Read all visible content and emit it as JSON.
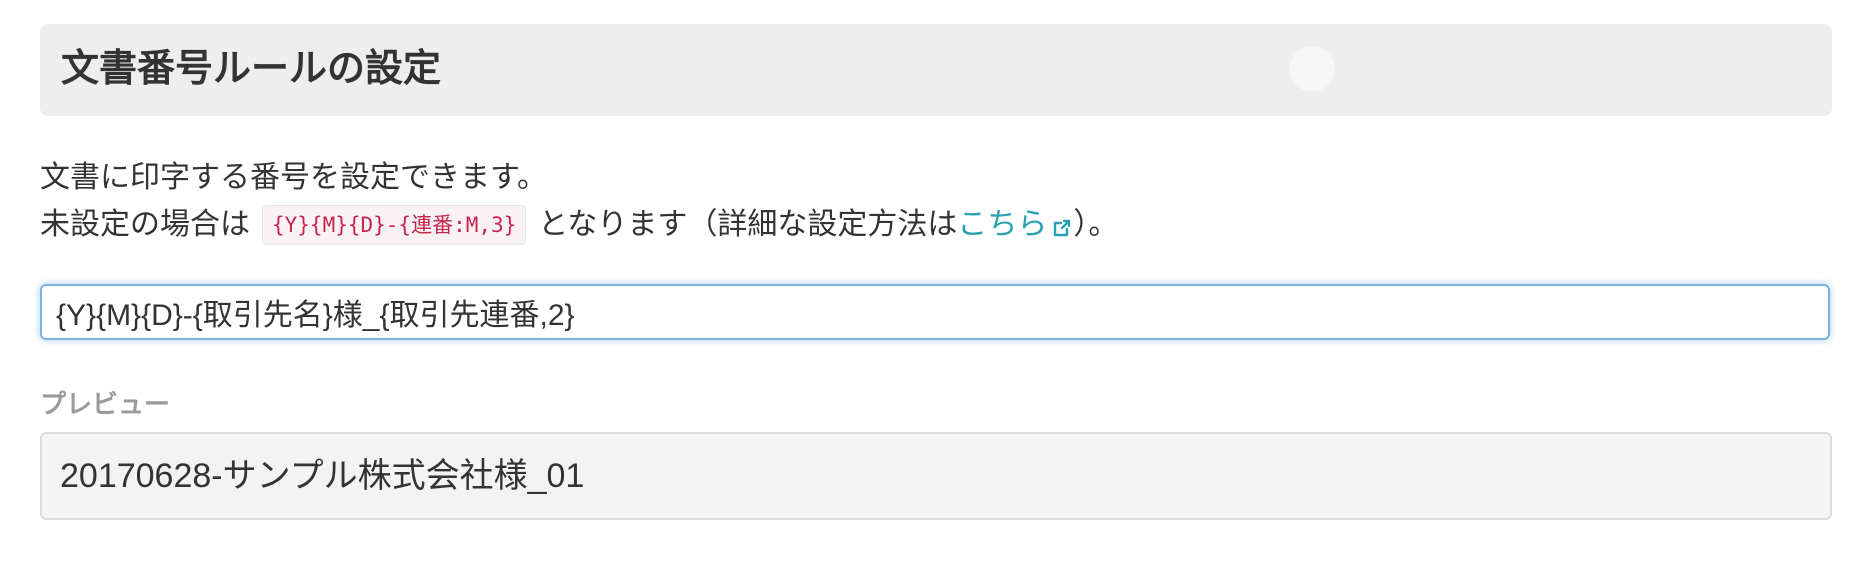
{
  "header": {
    "title": "文書番号ルールの設定"
  },
  "description": {
    "line1": "文書に印字する番号を設定できます。",
    "line2_prefix": "未設定の場合は",
    "default_rule": "{Y}{M}{D}-{連番:M,3}",
    "line2_middle": "となります（詳細な設定方法は",
    "help_link_label": "こちら",
    "help_link_icon": "external-link-icon",
    "line2_suffix": "）。"
  },
  "rule_input": {
    "value": "{Y}{M}{D}-{取引先名}様_{取引先連番,2}"
  },
  "preview": {
    "label": "プレビュー",
    "value": "20170628-サンプル株式会社様_01"
  },
  "colors": {
    "link": "#2aa1b3",
    "code_text": "#c7254e",
    "focus_border": "#7fb3e6"
  }
}
